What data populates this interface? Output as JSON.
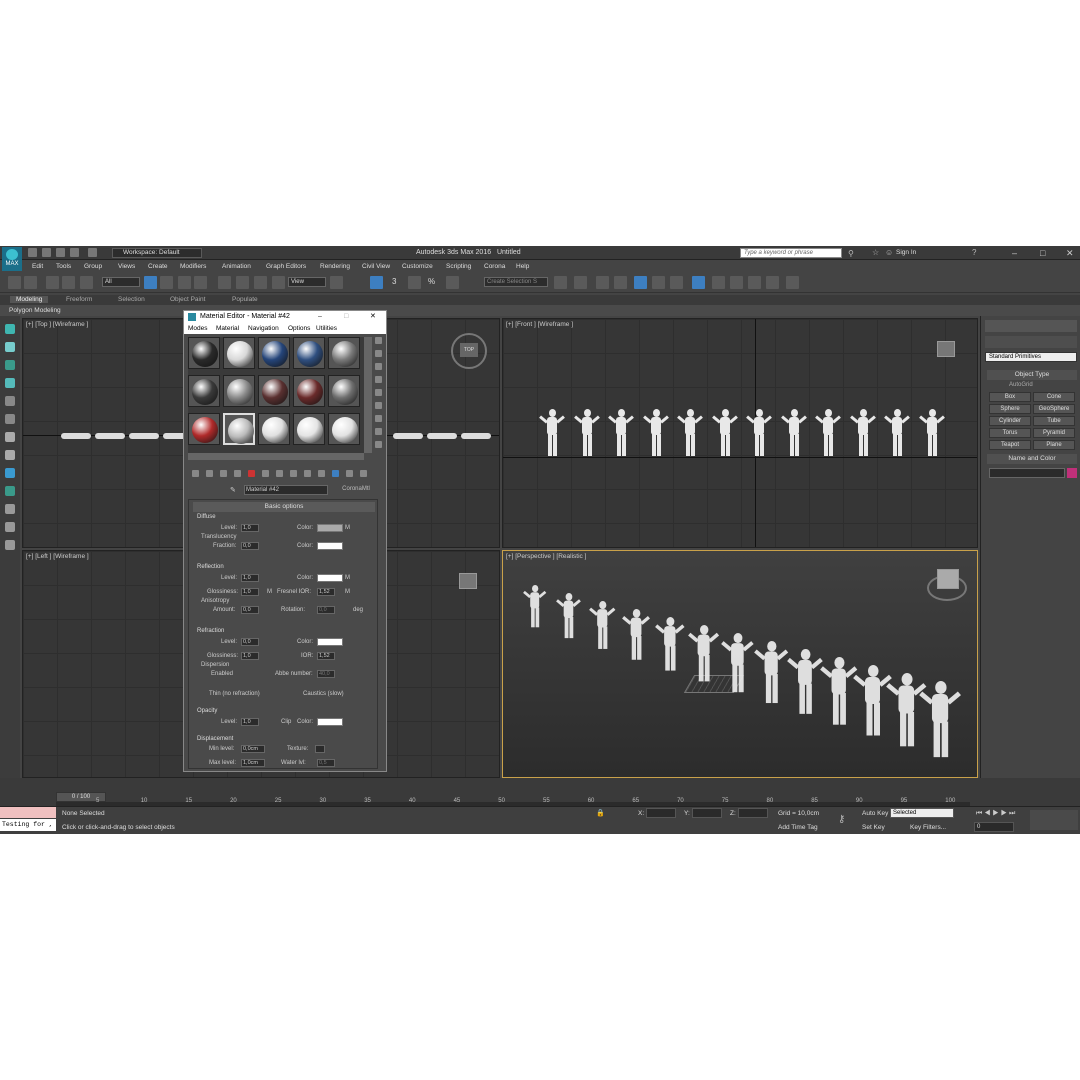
{
  "app": {
    "title": "Autodesk 3ds Max 2016",
    "file": "Untitled",
    "logo_text": "MAX"
  },
  "workspace": {
    "label": "Workspace: Default"
  },
  "search": {
    "placeholder": "Type a keyword or phrase"
  },
  "account": {
    "sign_in": "Sign In"
  },
  "menu": [
    "Edit",
    "Tools",
    "Group",
    "Views",
    "Create",
    "Modifiers",
    "Animation",
    "Graph Editors",
    "Rendering",
    "Civil View",
    "Customize",
    "Scripting",
    "Corona",
    "Help"
  ],
  "toolbar": {
    "filter": "All",
    "ref_coord": "View",
    "selection_set": "Create Selection S",
    "snap_3": "3",
    "snap_pct": "%"
  },
  "ribbon": {
    "tabs": [
      "Modeling",
      "Freeform",
      "Selection",
      "Object Paint",
      "Populate"
    ],
    "active": "Modeling",
    "sub": "Polygon Modeling"
  },
  "viewports": {
    "top": "[+] [Top ] [Wireframe ]",
    "front": "[+] [Front ] [Wireframe ]",
    "left": "[+] [Left ] [Wireframe ]",
    "perspective": "[+] [Perspective ] [Realistic ]",
    "viewcube_top": "TOP"
  },
  "material_editor": {
    "title": "Material Editor - Material #42",
    "menu": [
      "Modes",
      "Material",
      "Navigation",
      "Options",
      "Utilities"
    ],
    "material_name": "Material #42",
    "material_type": "CoronaMtl",
    "rollout": "Basic options",
    "diffuse": {
      "header": "Diffuse",
      "level_label": "Level:",
      "level": "1,0",
      "color_label": "Color:",
      "map": "M"
    },
    "translucency": {
      "header": "Translucency",
      "fraction_label": "Fraction:",
      "fraction": "0,0",
      "color_label": "Color:"
    },
    "reflection": {
      "header": "Reflection",
      "level_label": "Level:",
      "level": "1,0",
      "color_label": "Color:",
      "map": "M",
      "gloss_label": "Glossiness:",
      "gloss": "1,0",
      "gloss_map": "M",
      "ior_label": "Fresnel IOR:",
      "ior": "1,52",
      "ior_map": "M"
    },
    "anisotropy": {
      "header": "Anisotropy",
      "amount_label": "Amount:",
      "amount": "0,0",
      "rotation_label": "Rotation:",
      "rotation": "0,0",
      "unit": "deg"
    },
    "refraction": {
      "header": "Refraction",
      "level_label": "Level:",
      "level": "0,0",
      "color_label": "Color:",
      "gloss_label": "Glossiness:",
      "gloss": "1,0",
      "ior_label": "IOR:",
      "ior": "1,52"
    },
    "dispersion": {
      "header": "Dispersion",
      "enabled": "Enabled",
      "abbe_label": "Abbe number:",
      "abbe": "40,0",
      "thin": "Thin (no refraction)",
      "caustics": "Caustics (slow)"
    },
    "opacity": {
      "header": "Opacity",
      "level_label": "Level:",
      "level": "1,0",
      "clip": "Clip",
      "color_label": "Color:"
    },
    "displacement": {
      "header": "Displacement",
      "min_label": "Min level:",
      "min": "0,0cm",
      "texture_label": "Texture:",
      "max_label": "Max level:",
      "max": "1,0cm",
      "water_label": "Water lvl:",
      "water": "0,5"
    },
    "spheres": [
      {
        "fill": "#2a2a2a"
      },
      {
        "fill": "#d8d8d8"
      },
      {
        "fill": "#25457a"
      },
      {
        "fill": "#2f4f80"
      },
      {
        "fill": "#7a7a7a"
      },
      {
        "fill": "#3a3a3a"
      },
      {
        "fill": "#8a8a8a"
      },
      {
        "fill": "#5a3030"
      },
      {
        "fill": "#6a2a2a"
      },
      {
        "fill": "#6e6e6e"
      },
      {
        "fill": "#b02a2a"
      },
      {
        "fill": "#bbbbbb"
      },
      {
        "fill": "#e0e0e0"
      },
      {
        "fill": "#e4e4e4"
      },
      {
        "fill": "#e2e2e2"
      }
    ]
  },
  "command_panel": {
    "dropdown": "Standard Primitives",
    "object_type": "Object Type",
    "autogrid": "AutoGrid",
    "buttons": [
      "Box",
      "Cone",
      "Sphere",
      "GeoSphere",
      "Cylinder",
      "Tube",
      "Torus",
      "Pyramid",
      "Teapot",
      "Plane"
    ],
    "name_color": "Name and Color",
    "color": "#c0307a"
  },
  "timeline": {
    "slider": "0 / 100",
    "ticks": [
      "5",
      "10",
      "15",
      "20",
      "25",
      "30",
      "35",
      "40",
      "45",
      "50",
      "55",
      "60",
      "65",
      "70",
      "75",
      "80",
      "85",
      "90",
      "95",
      "100"
    ]
  },
  "status": {
    "selection": "None Selected",
    "prompt": "Click or click-and-drag to select objects",
    "grid": "Grid = 10,0cm",
    "add_time_tag": "Add Time Tag",
    "auto_key": "Auto Key",
    "auto_key_value": "Selected",
    "set_key": "Set Key",
    "key_filters": "Key Filters...",
    "frame": "0",
    "x_label": "X:",
    "y_label": "Y:",
    "z_label": "Z:",
    "maxscript": "Testing for ,"
  }
}
